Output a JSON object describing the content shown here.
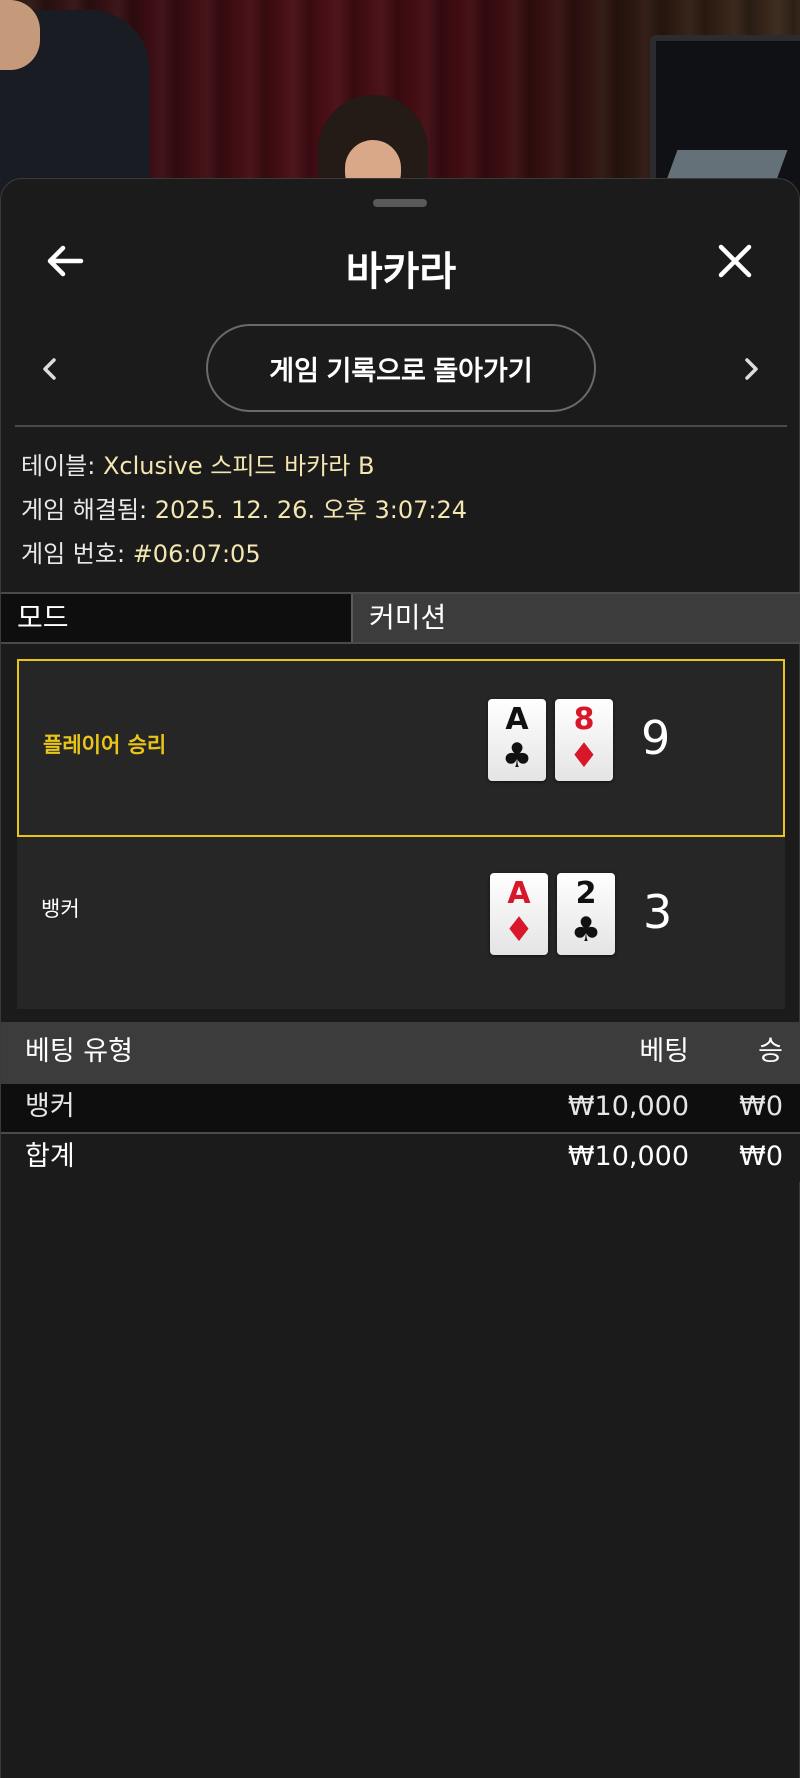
{
  "header": {
    "title": "바카라"
  },
  "nav": {
    "history_button": "게임 기록으로 돌아가기"
  },
  "info": {
    "table_label": "테이블:",
    "table_value": "Xclusive 스피드 바카라 B",
    "resolved_label": "게임 해결됨:",
    "resolved_value": "2025. 12. 26. 오후 3:07:24",
    "game_no_label": "게임 번호:",
    "game_no_value": "#06:07:05"
  },
  "mode": {
    "label": "모드",
    "value": "커미션"
  },
  "result": {
    "player": {
      "label": "플레이어 승리",
      "cards": [
        {
          "rank": "A",
          "suit": "♣",
          "color": "black"
        },
        {
          "rank": "8",
          "suit": "♦",
          "color": "red"
        }
      ],
      "score": "9"
    },
    "banker": {
      "label": "뱅커",
      "cards": [
        {
          "rank": "A",
          "suit": "♦",
          "color": "red"
        },
        {
          "rank": "2",
          "suit": "♣",
          "color": "black"
        }
      ],
      "score": "3"
    }
  },
  "bets": {
    "headers": {
      "type": "베팅 유형",
      "bet": "베팅",
      "win": "승"
    },
    "rows": [
      {
        "type": "뱅커",
        "bet": "₩10,000",
        "win": "₩0"
      }
    ],
    "total": {
      "type": "합계",
      "bet": "₩10,000",
      "win": "₩0"
    }
  },
  "colors": {
    "accent": "#e8c619",
    "info_value": "#f3e6b0"
  }
}
